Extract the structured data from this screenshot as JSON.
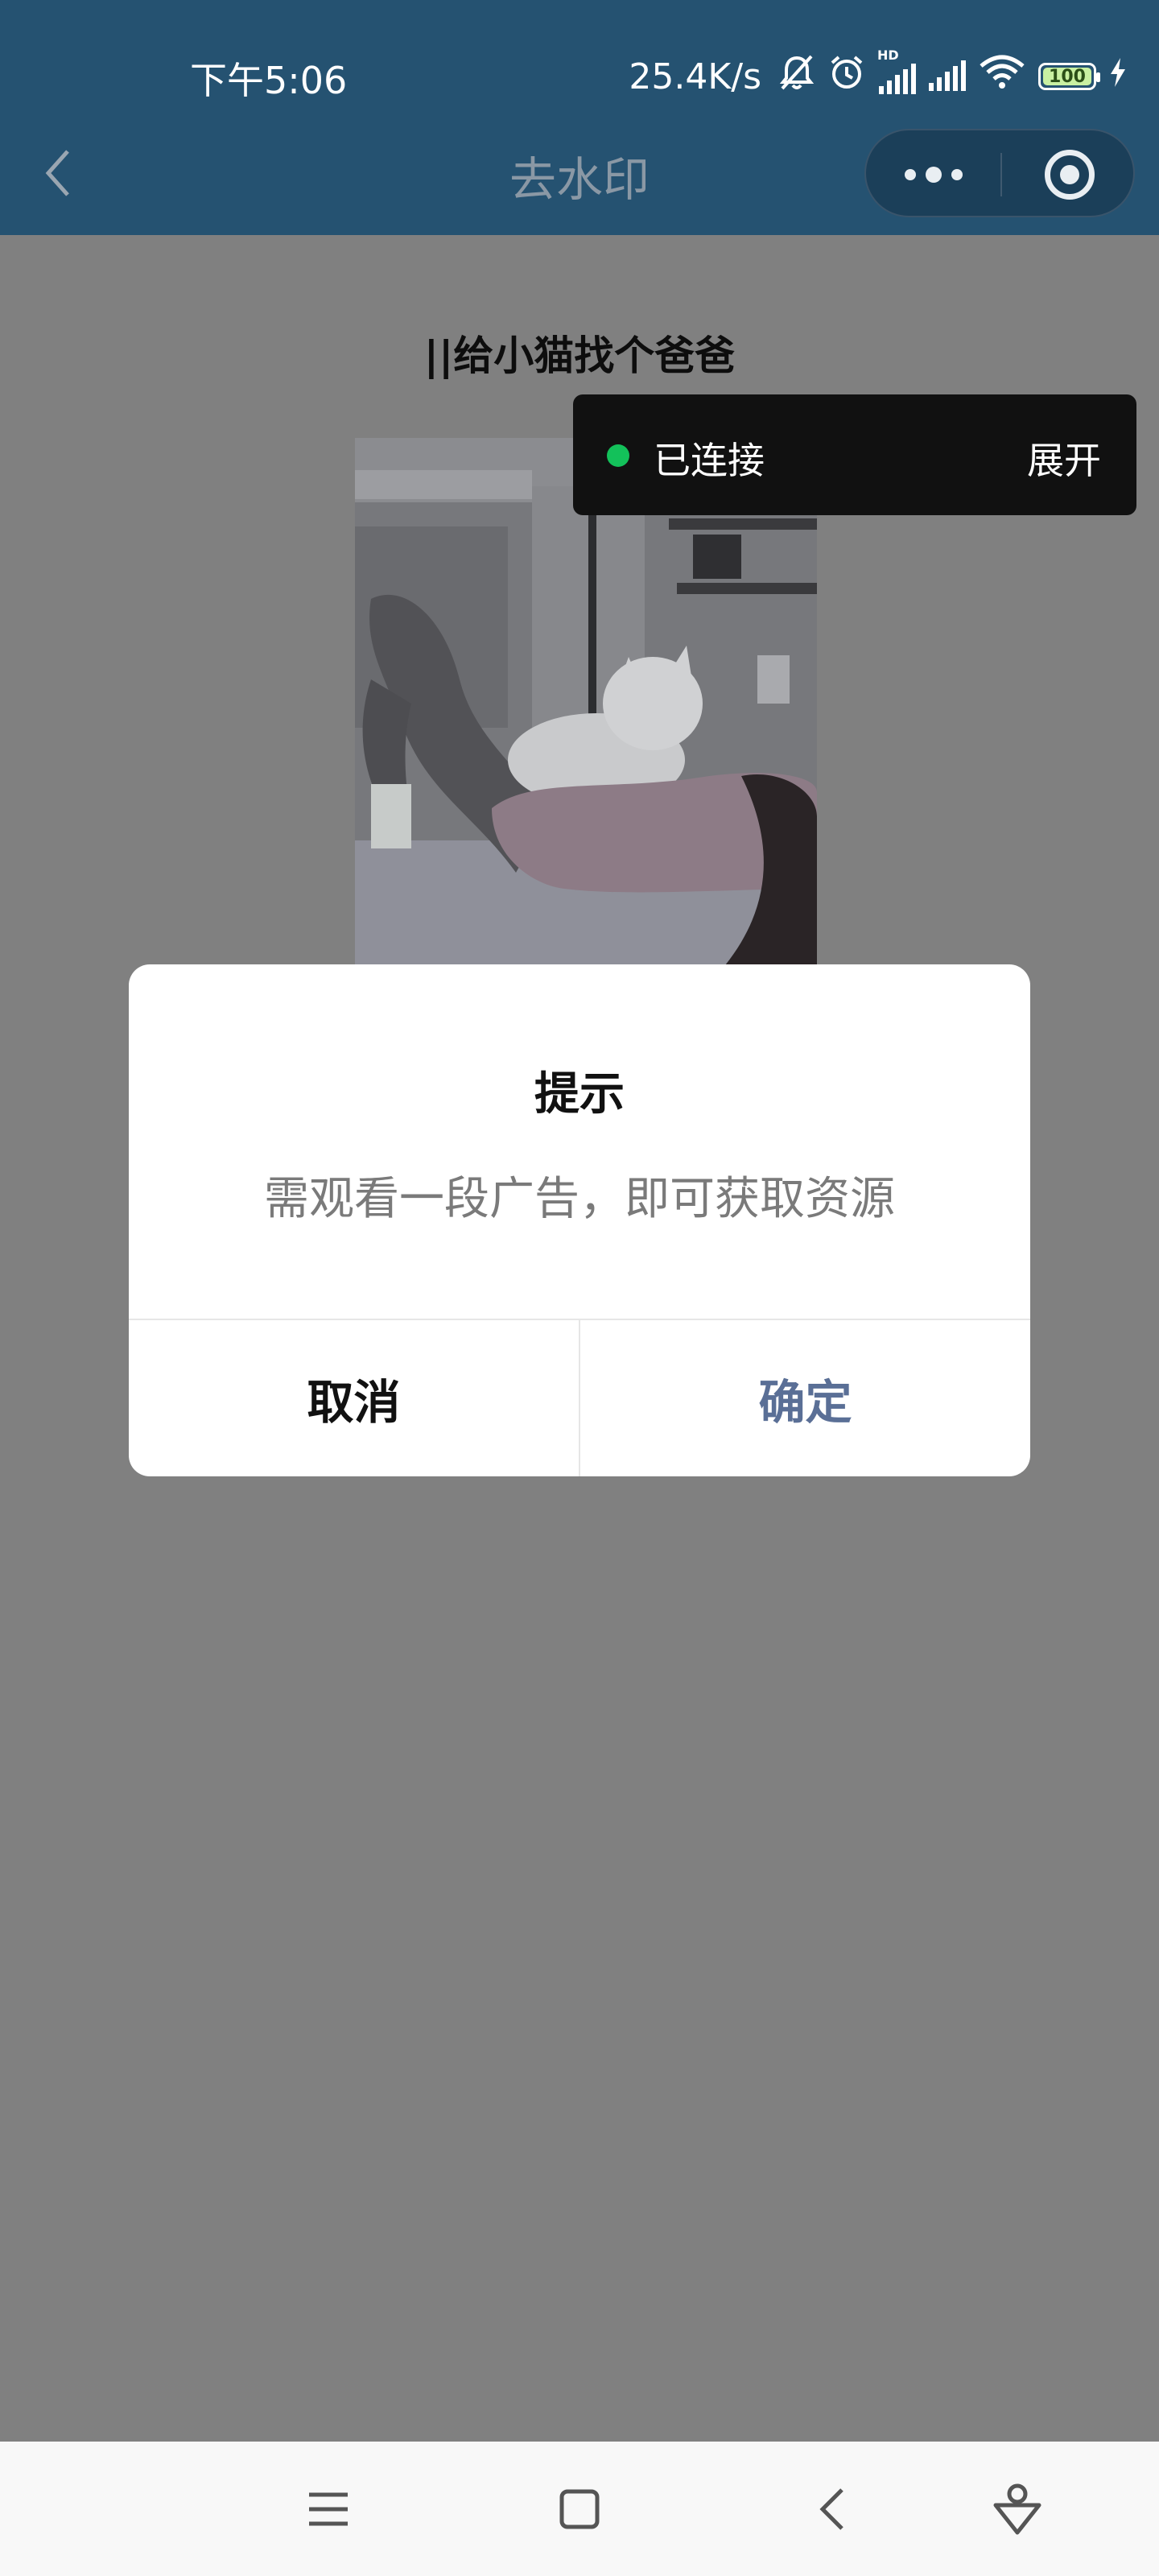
{
  "status_bar": {
    "time": "下午5:06",
    "net_speed": "25.4K/s",
    "hd_badge": "HD",
    "battery_level": "100",
    "icons": [
      "bell-muted-icon",
      "alarm-icon",
      "signal-icon",
      "wifi-icon",
      "battery-icon",
      "charging-icon"
    ]
  },
  "nav": {
    "title": "去水印",
    "back_icon": "chevron-left-icon",
    "more_icon": "more-dots-icon",
    "close_icon": "target-circle-icon"
  },
  "post": {
    "title": "||给小猫找个爸爸"
  },
  "connection": {
    "status": "已连接",
    "expand_label": "展开",
    "status_color": "#13c15a"
  },
  "dialog": {
    "title": "提示",
    "message": "需观看一段广告，即可获取资源",
    "cancel_label": "取消",
    "confirm_label": "确定",
    "confirm_color": "#5a6f96"
  },
  "system_nav": {
    "icons": [
      "menu-icon",
      "home-square-icon",
      "back-chevron-icon",
      "assistant-icon"
    ]
  },
  "colors": {
    "header": "#255271",
    "overlay": "#808080"
  }
}
